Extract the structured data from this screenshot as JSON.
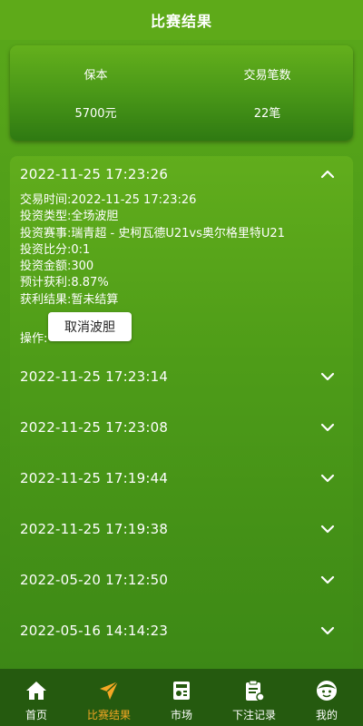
{
  "header": {
    "title": "比赛结果"
  },
  "summary": {
    "principal_label": "保本",
    "principal_value": "5700元",
    "count_label": "交易笔数",
    "count_value": "22笔"
  },
  "records": [
    {
      "date": "2022-11-25 17:23:26",
      "expanded": true,
      "details": {
        "trade_time": "交易时间:2022-11-25 17:23:26",
        "invest_type": "投资类型:全场波胆",
        "match": "投资赛事:瑞青超 - 史柯瓦德U21vs奥尔格里特U21",
        "score": "投资比分:0:1",
        "amount": "投资金额:300",
        "expected_profit": "预计获利:8.87%",
        "result": "获利结果:暂未结算",
        "operation": "操作:",
        "cancel_button": "取消波胆"
      }
    },
    {
      "date": "2022-11-25 17:23:14"
    },
    {
      "date": "2022-11-25 17:23:08"
    },
    {
      "date": "2022-11-25 17:19:44"
    },
    {
      "date": "2022-11-25 17:19:38"
    },
    {
      "date": "2022-05-20 17:12:50"
    },
    {
      "date": "2022-05-16 14:14:23"
    }
  ],
  "tabbar": {
    "items": [
      {
        "label": "首页",
        "icon": "home-icon"
      },
      {
        "label": "比赛结果",
        "icon": "paper-plane-icon",
        "active": true
      },
      {
        "label": "市场",
        "icon": "market-icon"
      },
      {
        "label": "下注记录",
        "icon": "clipboard-icon"
      },
      {
        "label": "我的",
        "icon": "face-icon"
      }
    ],
    "active_color": "#f4a724"
  }
}
